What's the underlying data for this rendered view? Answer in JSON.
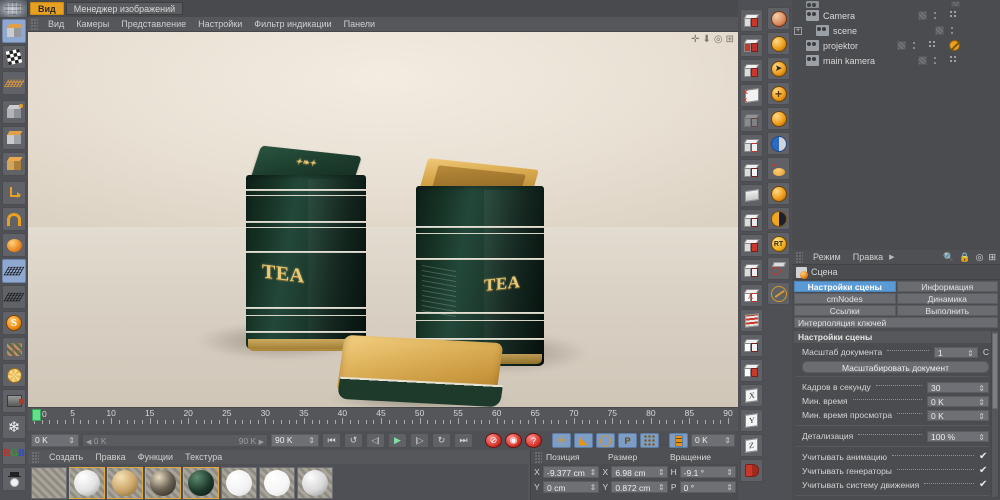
{
  "app": {
    "tabs": [
      {
        "label": "Вид",
        "active": true
      },
      {
        "label": "Менеджер изображений",
        "active": false
      }
    ]
  },
  "viewport_menu": {
    "items": [
      "Вид",
      "Камеры",
      "Представление",
      "Настройки",
      "Фильтр индикации",
      "Панели"
    ]
  },
  "viewport": {
    "nav_icons": [
      "move-icon",
      "down-arrow-icon",
      "orbit-icon",
      "maximize-icon"
    ],
    "scene_label_tea": "TEA"
  },
  "object_manager": {
    "rows": [
      {
        "label": "Camera",
        "icon": "camera-object-icon",
        "hidden_badge": false
      },
      {
        "label": "scene",
        "icon": "scene-object-icon",
        "hidden_badge": false,
        "expandable": true
      },
      {
        "label": "projektor",
        "icon": "light-object-icon",
        "hidden_badge": true
      },
      {
        "label": "main kamera",
        "icon": "camera-object-icon",
        "hidden_badge": false
      }
    ]
  },
  "attributes": {
    "menu": [
      "Режим",
      "Правка"
    ],
    "toolbar_icons": [
      "search-icon",
      "lock-icon",
      "target-icon",
      "panel-icon"
    ],
    "object_title": "Сцена",
    "tabs": [
      {
        "label": "Настройки сцены",
        "active": true
      },
      {
        "label": "Информация",
        "active": false
      },
      {
        "label": "cmNodes",
        "active": false
      },
      {
        "label": "Динамика",
        "active": false
      },
      {
        "label": "Ссылки",
        "active": false
      },
      {
        "label": "Выполнить",
        "active": false
      },
      {
        "label": "Интерполяция ключей",
        "active": false,
        "wide": true
      }
    ],
    "section_title": "Настройки сцены",
    "fields": [
      {
        "label": "Масштаб документа",
        "value": "1",
        "type": "field-unit"
      },
      {
        "label": "Масштабировать документ",
        "type": "button"
      },
      {
        "label": "Кадров в секунду",
        "value": "30",
        "type": "field"
      },
      {
        "label": "Мин. время",
        "value": "0 K",
        "type": "field"
      },
      {
        "label": "Мин. время просмотра",
        "value": "0 K",
        "type": "field"
      },
      {
        "label": "Детализация",
        "value": "100 %",
        "type": "field"
      },
      {
        "label": "Учитывать анимацию",
        "value": "✔",
        "type": "check"
      },
      {
        "label": "Учитывать генераторы",
        "value": "✔",
        "type": "check"
      },
      {
        "label": "Учитывать систему движения",
        "value": "✔",
        "type": "check"
      }
    ],
    "unit_suffix": "C"
  },
  "timeline": {
    "ticks": [
      0,
      5,
      10,
      15,
      20,
      25,
      30,
      35,
      40,
      45,
      50,
      55,
      60,
      65,
      70,
      75,
      80,
      85,
      90
    ],
    "playhead_frame": "0",
    "current_time": "0 K",
    "range_start": "0 K",
    "range_end": "90 K",
    "end_field": "90 K",
    "extra_field": "0 K",
    "transport": [
      {
        "name": "go-to-start-button",
        "glyph": "⏮"
      },
      {
        "name": "step-back-keyframe-button",
        "glyph": "↺"
      },
      {
        "name": "step-back-frame-button",
        "glyph": "◁|"
      },
      {
        "name": "play-button",
        "glyph": "▶"
      },
      {
        "name": "step-forward-frame-button",
        "glyph": "|▷"
      },
      {
        "name": "step-forward-keyframe-button",
        "glyph": "↻"
      },
      {
        "name": "go-to-end-button",
        "glyph": "⏭"
      }
    ],
    "record_buttons": [
      {
        "name": "record-active-objects-button",
        "glyph": "⊘"
      },
      {
        "name": "autokeying-button",
        "glyph": "◉"
      },
      {
        "name": "keyframe-selection-button",
        "glyph": "?"
      }
    ],
    "key_toggles": [
      {
        "name": "position-key-toggle",
        "glyph": "✛"
      },
      {
        "name": "scale-key-toggle",
        "glyph": "◣"
      },
      {
        "name": "rotation-key-toggle",
        "glyph": "◯"
      },
      {
        "name": "parameter-key-toggle",
        "glyph": "P"
      },
      {
        "name": "pla-key-toggle",
        "glyph": "⣿"
      }
    ]
  },
  "material_manager": {
    "menu": [
      "Создать",
      "Правка",
      "Функции",
      "Текстура"
    ],
    "materials": [
      {
        "name": "checker-swatch",
        "color": "",
        "selected": false,
        "kind": "pattern"
      },
      {
        "name": "white-material",
        "color": "#e6e6e6",
        "selected": true,
        "kind": "sphere"
      },
      {
        "name": "gold-material",
        "color": "#c9a468",
        "selected": true,
        "kind": "sphere"
      },
      {
        "name": "label-material",
        "color": "#6b6155",
        "selected": true,
        "kind": "sphere"
      },
      {
        "name": "green-material",
        "color": "#1d3a2b",
        "selected": true,
        "kind": "sphere"
      },
      {
        "name": "white-material-2",
        "color": "#f2f2f2",
        "selected": false,
        "kind": "sphere"
      },
      {
        "name": "white-material-3",
        "color": "#f5f5f5",
        "selected": false,
        "kind": "sphere"
      },
      {
        "name": "grey-material",
        "color": "#d8d8d8",
        "selected": false,
        "kind": "sphere"
      }
    ]
  },
  "coordinates": {
    "headers": [
      "Позиция",
      "Размер",
      "Вращение"
    ],
    "rows": [
      {
        "pos_label": "X",
        "pos_value": "-9.377 cm",
        "size_label": "X",
        "size_value": "6.98 cm",
        "rot_label": "H",
        "rot_value": "-9.1 °"
      },
      {
        "pos_label": "Y",
        "pos_value": "0 cm",
        "size_label": "Y",
        "size_value": "0.872 cm",
        "rot_label": "P",
        "rot_value": "0 °"
      }
    ]
  },
  "left_toolbar": {
    "items": [
      {
        "name": "selection-tool",
        "selected": true
      },
      {
        "name": "render-view-tool",
        "selected": false
      },
      {
        "name": "grid-tool",
        "selected": false
      },
      {
        "name": "make-editable-tool",
        "selected": false
      },
      {
        "name": "model-mode-tool",
        "selected": false
      },
      {
        "name": "object-axis-tool",
        "selected": false
      },
      {
        "name": "world-axis-tool",
        "selected": false
      },
      {
        "name": "magnet-tool",
        "selected": false
      },
      {
        "name": "texture-axis-tool",
        "selected": false
      },
      {
        "name": "lock-axis-tool",
        "selected": true
      },
      {
        "name": "animation-tool",
        "selected": false
      },
      {
        "name": "sketch-tool",
        "selected": false
      },
      {
        "name": "hair-tool",
        "selected": false
      },
      {
        "name": "mograph-tool",
        "selected": false
      },
      {
        "name": "camera-tool",
        "selected": false
      },
      {
        "name": "snowflake-tool",
        "selected": false
      },
      {
        "name": "rgb-tool",
        "selected": false
      },
      {
        "name": "character-tool",
        "selected": false
      }
    ]
  },
  "right_toolbar_a": {
    "items": [
      {
        "name": "add-cube-primitive"
      },
      {
        "name": "spline-tool"
      },
      {
        "name": "nurbs-tool"
      },
      {
        "name": "array-tool"
      },
      {
        "name": "deformer-tool"
      },
      {
        "name": "scene-object-tool"
      },
      {
        "name": "physics-sky-tool"
      },
      {
        "name": "camera-object-tool"
      },
      {
        "name": "light-object-tool"
      },
      {
        "name": "material-tag-tool"
      },
      {
        "name": "symmetry-tool"
      },
      {
        "name": "boole-tool"
      },
      {
        "name": "instance-tool"
      },
      {
        "name": "metaball-tool"
      },
      {
        "name": "atom-array-tool"
      },
      {
        "name": "xpresso-tool"
      },
      {
        "name": "axis-x-tool"
      },
      {
        "name": "axis-y-tool"
      },
      {
        "name": "axis-z-tool"
      },
      {
        "name": "bend-tool"
      }
    ]
  },
  "right_toolbar_b": {
    "items": [
      {
        "name": "render-preview-tool"
      },
      {
        "name": "render-region-tool"
      },
      {
        "name": "render-settings-tool"
      },
      {
        "name": "add-object-tool"
      },
      {
        "name": "light-tool"
      },
      {
        "name": "camera-nav-tool"
      },
      {
        "name": "deform-tool"
      },
      {
        "name": "sphere-tool"
      },
      {
        "name": "contrast-tool"
      },
      {
        "name": "realtime-render-tool"
      },
      {
        "name": "paint-tool"
      },
      {
        "name": "measure-tool"
      }
    ]
  }
}
